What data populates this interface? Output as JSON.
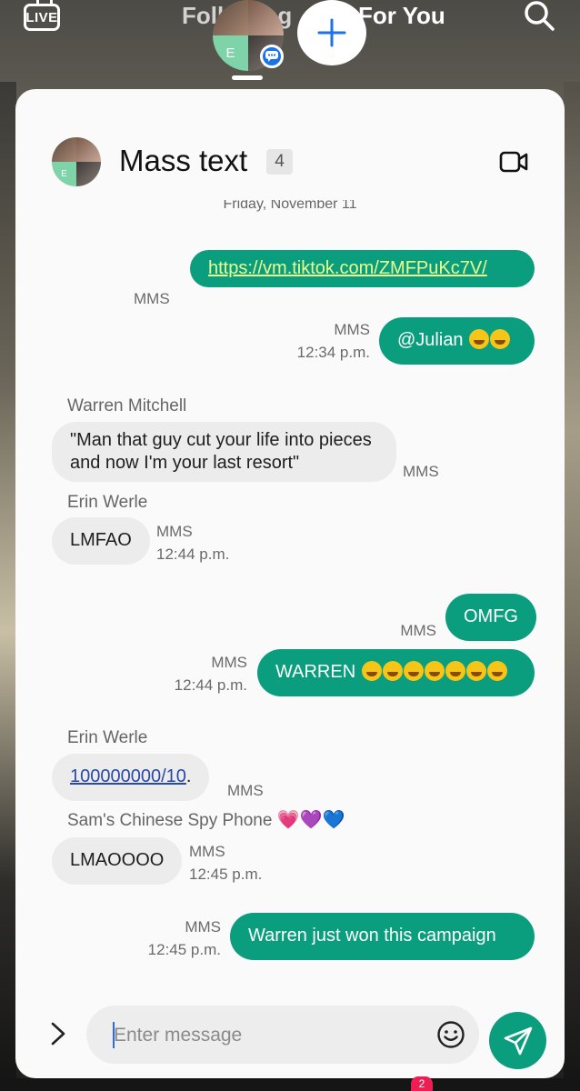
{
  "tiktok": {
    "live_label": "LIVE",
    "tab_following": "Following",
    "tab_foryou": "For You",
    "nav_badge": "2"
  },
  "chat": {
    "title": "Mass text",
    "member_count": "4",
    "avatar_letter": "E",
    "date_separator": "Friday, November 11",
    "messages": [
      {
        "dir": "out",
        "text": "https://vm.tiktok.com/ZMFPuKc7V/",
        "type": "MMS",
        "time": ""
      },
      {
        "dir": "out",
        "text": "@Julian",
        "emoji": "😁😁",
        "type": "MMS",
        "time": "12:34 p.m."
      },
      {
        "dir": "in",
        "sender": "Warren Mitchell",
        "text": "\"Man that guy cut your life into pieces and now I'm your last resort\"",
        "type": "MMS",
        "time": ""
      },
      {
        "dir": "in",
        "sender": "Erin Werle",
        "text": "LMFAO",
        "type": "MMS",
        "time": "12:44 p.m."
      },
      {
        "dir": "out",
        "text": "OMFG",
        "type": "MMS",
        "time": ""
      },
      {
        "dir": "out",
        "text": "WARREN",
        "emoji": "🤣🤣🤣🤣🤣🤣🤣",
        "type": "MMS",
        "time": "12:44 p.m."
      },
      {
        "dir": "in",
        "sender": "Erin Werle",
        "text": "100000000/10",
        "suffix": ".",
        "type": "MMS",
        "time": ""
      },
      {
        "dir": "in",
        "sender": "Sam's Chinese Spy Phone",
        "sender_emoji": "💗💜💙",
        "text": "LMAOOOO",
        "type": "MMS",
        "time": "12:45 p.m."
      },
      {
        "dir": "out",
        "text": "Warren just won this campaign",
        "type": "MMS",
        "time": "12:45 p.m."
      }
    ]
  },
  "composer": {
    "placeholder": "Enter message"
  },
  "colors": {
    "accent": "#0a9e7e",
    "incoming_bubble": "#ececec",
    "link_outgoing": "#eaff8c",
    "link_incoming": "#2a48a8"
  },
  "icons": [
    "live-icon",
    "search-icon",
    "plus-icon",
    "chat-bubble-icon",
    "video-call-icon",
    "chevron-right-icon",
    "emoji-icon",
    "send-icon"
  ]
}
